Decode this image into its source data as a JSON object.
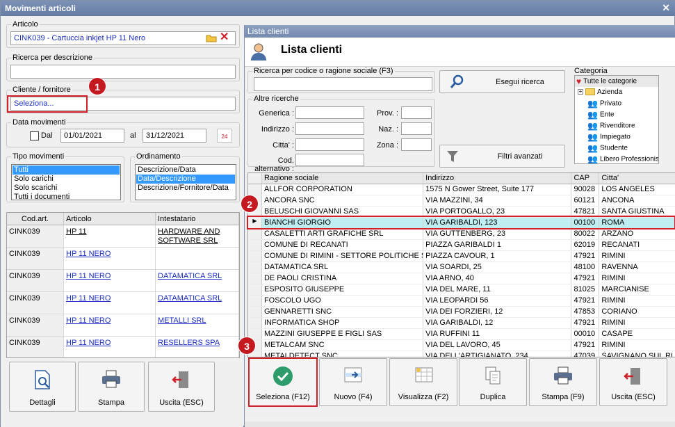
{
  "window": {
    "title": "Movimenti articoli",
    "close": "✕"
  },
  "left": {
    "articolo": {
      "label": "Articolo",
      "value": "CINK039 - Cartuccia inkjet HP 11 Nero"
    },
    "ricerca": {
      "label": "Ricerca per descrizione",
      "value": ""
    },
    "cliente": {
      "label": "Cliente / fornitore",
      "value": "Seleziona..."
    },
    "data": {
      "label": "Data movimenti",
      "dal_label": "Dal",
      "dal": "01/01/2021",
      "al_label": "al",
      "al": "31/12/2021",
      "cal_text": "24"
    },
    "tipo": {
      "label": "Tipo movimenti",
      "items": [
        "Tutti",
        "Solo carichi",
        "Solo scarichi",
        "Tutti i documenti"
      ]
    },
    "ordinamento": {
      "label": "Ordinamento",
      "items": [
        "Descrizione/Data",
        "Data/Descrizione",
        "Descrizione/Fornitore/Data"
      ]
    },
    "table": {
      "headers": [
        "Cod.art.",
        "Articolo",
        "Intestatario"
      ],
      "rows": [
        {
          "cod": "CINK039",
          "art": "HP 11",
          "int": "HARDWARE AND SOFTWARE SRL"
        },
        {
          "cod": "CINK039",
          "art": "HP 11 NERO",
          "int": ""
        },
        {
          "cod": "CINK039",
          "art": "HP 11 NERO",
          "int": "DATAMATICA SRL"
        },
        {
          "cod": "CINK039",
          "art": "HP 11 NERO",
          "int": "DATAMATICA SRL"
        },
        {
          "cod": "CINK039",
          "art": "HP 11 NERO",
          "int": "METALLI SRL"
        },
        {
          "cod": "CINK039",
          "art": "HP 11 NERO",
          "int": "RESELLERS SPA"
        }
      ]
    },
    "buttons": {
      "dettagli": "Dettagli",
      "stampa": "Stampa",
      "uscita": "Uscita (ESC)"
    }
  },
  "right": {
    "title": "Lista clienti",
    "heading": "Lista clienti",
    "ricerca_label": "Ricerca per codice o ragione sociale (F3)",
    "esegui": "Esegui ricerca",
    "altre": "Altre ricerche",
    "fields": {
      "generica": "Generica :",
      "indirizzo": "Indirizzo :",
      "citta": "Citta' :",
      "codalt": "Cod. alternativo :",
      "prov": "Prov. :",
      "naz": "Naz. :",
      "zona": "Zona :"
    },
    "filtri": "Filtri avanzati",
    "categoria": {
      "label": "Categoria",
      "items": [
        "Tutte le categorie",
        "Azienda",
        "Privato",
        "Ente",
        "Rivenditore",
        "Impiegato",
        "Studente",
        "Libero Professionista"
      ]
    },
    "table": {
      "headers": [
        "Ragione sociale",
        "Indirizzo",
        "CAP",
        "Citta'"
      ],
      "rows": [
        [
          "ALLFOR CORPORATION",
          "1575 N Gower Street, Suite 177",
          "90028",
          "LOS ANGELES"
        ],
        [
          "ANCORA SNC",
          "VIA MAZZINI, 34",
          "60121",
          "ANCONA"
        ],
        [
          "BELUSCHI GIOVANNI SAS",
          "VIA PORTOGALLO, 23",
          "47821",
          "SANTA GIUSTINA"
        ],
        [
          "BIANCHI GIORGIO",
          "VIA GARIBALDI, 123",
          "00100",
          "ROMA"
        ],
        [
          "CASALETTI ARTI GRAFICHE SRL",
          "VIA GUTTENBERG, 23",
          "80022",
          "ARZANO"
        ],
        [
          "COMUNE DI RECANATI",
          "PIAZZA GARIBALDI 1",
          "62019",
          "RECANATI"
        ],
        [
          "COMUNE DI RIMINI - SETTORE POLITICHE S...",
          "PIAZZA CAVOUR, 1",
          "47921",
          "RIMINI"
        ],
        [
          "DATAMATICA SRL",
          "VIA SOARDI, 25",
          "48100",
          "RAVENNA"
        ],
        [
          "DE PAOLI CRISTINA",
          "VIA ARNO, 40",
          "47921",
          "RIMINI"
        ],
        [
          "ESPOSITO GIUSEPPE",
          "VIA DEL MARE, 11",
          "81025",
          "MARCIANISE"
        ],
        [
          "FOSCOLO UGO",
          "VIA LEOPARDI 56",
          "47921",
          "RIMINI"
        ],
        [
          "GENNARETTI SNC",
          "VIA DEI FORZIERI, 12",
          "47853",
          "CORIANO"
        ],
        [
          "INFORMATICA SHOP",
          "VIA GARIBALDI, 12",
          "47921",
          "RIMINI"
        ],
        [
          "MAZZINI GIUSEPPE E FIGLI SAS",
          "VIA RUFFINI 11",
          "00010",
          "CASAPE"
        ],
        [
          "METALCAM SNC",
          "VIA DEL LAVORO, 45",
          "47921",
          "RIMINI"
        ],
        [
          "METALDETECT SNC",
          "VIA DELL'ARTIGIANATO, 234",
          "47039",
          "SAVIGNANO SUL RUBICONE"
        ]
      ]
    },
    "buttons": {
      "seleziona": "Seleziona (F12)",
      "nuovo": "Nuovo (F4)",
      "visualizza": "Visualizza (F2)",
      "duplica": "Duplica",
      "stampa": "Stampa (F9)",
      "uscita": "Uscita (ESC)"
    }
  },
  "badges": [
    "1",
    "2",
    "3"
  ]
}
